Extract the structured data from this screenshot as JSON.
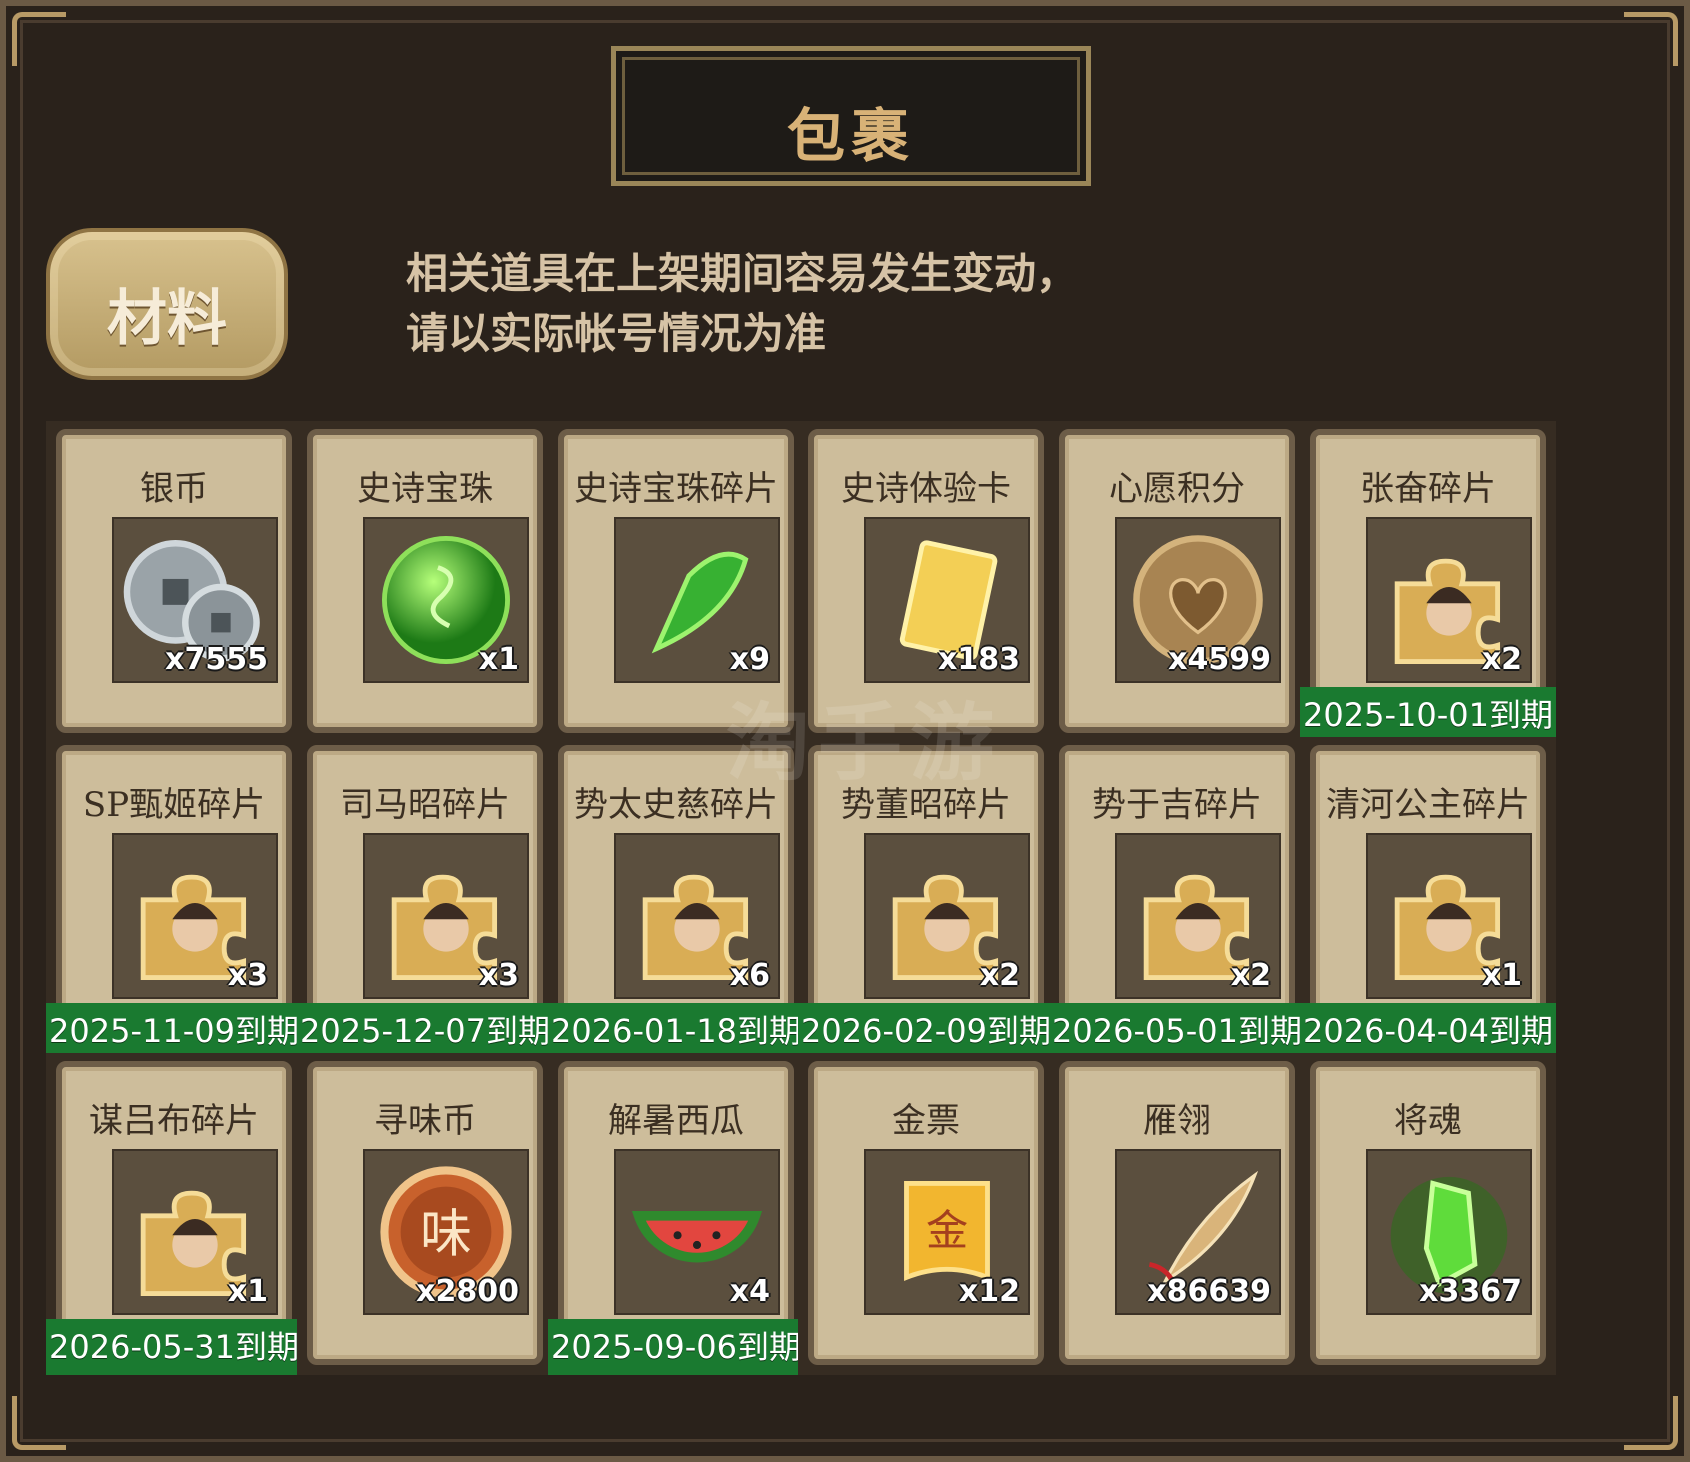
{
  "window": {
    "title": "包裹"
  },
  "category": {
    "tab_label": "材料"
  },
  "notice": {
    "line1": "相关道具在上架期间容易发生变动，",
    "line2": "请以实际帐号情况为准"
  },
  "watermark": "淘手游",
  "items": [
    {
      "name": "银币",
      "count": "x7555",
      "icon": "silver-coin-icon",
      "expire": ""
    },
    {
      "name": "史诗宝珠",
      "count": "x1",
      "icon": "epic-orb-icon",
      "expire": ""
    },
    {
      "name": "史诗宝珠碎片",
      "count": "x9",
      "icon": "epic-orb-shard-icon",
      "expire": ""
    },
    {
      "name": "史诗体验卡",
      "count": "x183",
      "icon": "gold-card-icon",
      "expire": ""
    },
    {
      "name": "心愿积分",
      "count": "x4599",
      "icon": "heart-coin-icon",
      "expire": ""
    },
    {
      "name": "张奋碎片",
      "count": "x2",
      "icon": "puzzle-shard-icon",
      "expire": "2025-10-01到期"
    },
    {
      "name": "SP甄姬碎片",
      "count": "x3",
      "icon": "puzzle-shard-icon",
      "expire": "2025-11-09到期"
    },
    {
      "name": "司马昭碎片",
      "count": "x3",
      "icon": "puzzle-shard-icon",
      "expire": "2025-12-07到期"
    },
    {
      "name": "势太史慈碎片",
      "count": "x6",
      "icon": "puzzle-shard-icon",
      "expire": "2026-01-18到期"
    },
    {
      "name": "势董昭碎片",
      "count": "x2",
      "icon": "puzzle-shard-icon",
      "expire": "2026-02-09到期"
    },
    {
      "name": "势于吉碎片",
      "count": "x2",
      "icon": "puzzle-shard-icon",
      "expire": "2026-05-01到期"
    },
    {
      "name": "清河公主碎片",
      "count": "x1",
      "icon": "puzzle-shard-icon",
      "expire": "2026-04-04到期"
    },
    {
      "name": "谋吕布碎片",
      "count": "x1",
      "icon": "puzzle-shard-icon",
      "expire": "2026-05-31到期"
    },
    {
      "name": "寻味币",
      "count": "x2800",
      "icon": "taste-coin-icon",
      "expire": ""
    },
    {
      "name": "解暑西瓜",
      "count": "x4",
      "icon": "watermelon-icon",
      "expire": "2025-09-06到期"
    },
    {
      "name": "金票",
      "count": "x12",
      "icon": "gold-ticket-icon",
      "expire": ""
    },
    {
      "name": "雁翎",
      "count": "x86639",
      "icon": "feather-icon",
      "expire": ""
    },
    {
      "name": "将魂",
      "count": "x3367",
      "icon": "soul-crystal-icon",
      "expire": ""
    }
  ],
  "colors": {
    "frame": "#2a221b",
    "card_bg": "#cdbd9b",
    "expire_bg": "#1a7a30",
    "gold_text": "#d8b277"
  }
}
